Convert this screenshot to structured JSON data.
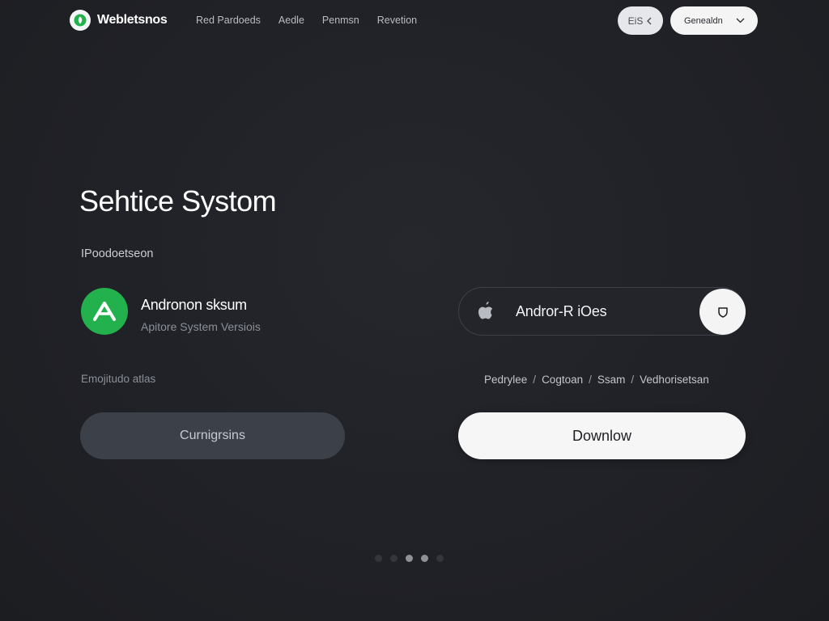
{
  "header": {
    "brand": "Webletsnos",
    "nav": [
      "Red Pardoeds",
      "Aedle",
      "Penmsn",
      "Revetion"
    ],
    "icon_pill_text": "EiS",
    "select": {
      "value": "Genealdn"
    }
  },
  "hero": {
    "title": "Sehtice Systom",
    "subtitle": "IPoodoetseon"
  },
  "android": {
    "title": "Andronon sksum",
    "subtitle": "Apitore System Versiois"
  },
  "ios": {
    "label": "Andror-R iOes"
  },
  "left_caption": "Emojitudo atlas",
  "breadcrumbs": [
    "Pedrylee",
    "Cogtoan",
    "Ssam",
    "Vedhorisetsan"
  ],
  "buttons": {
    "secondary": "Curnigrsins",
    "primary": "Downlow"
  },
  "carousel": {
    "count": 5,
    "active_index": 2
  },
  "colors": {
    "background": "#1f2025",
    "android_green": "#22b14c",
    "button_dark": "#3c4048",
    "button_light": "#f6f6f7"
  }
}
